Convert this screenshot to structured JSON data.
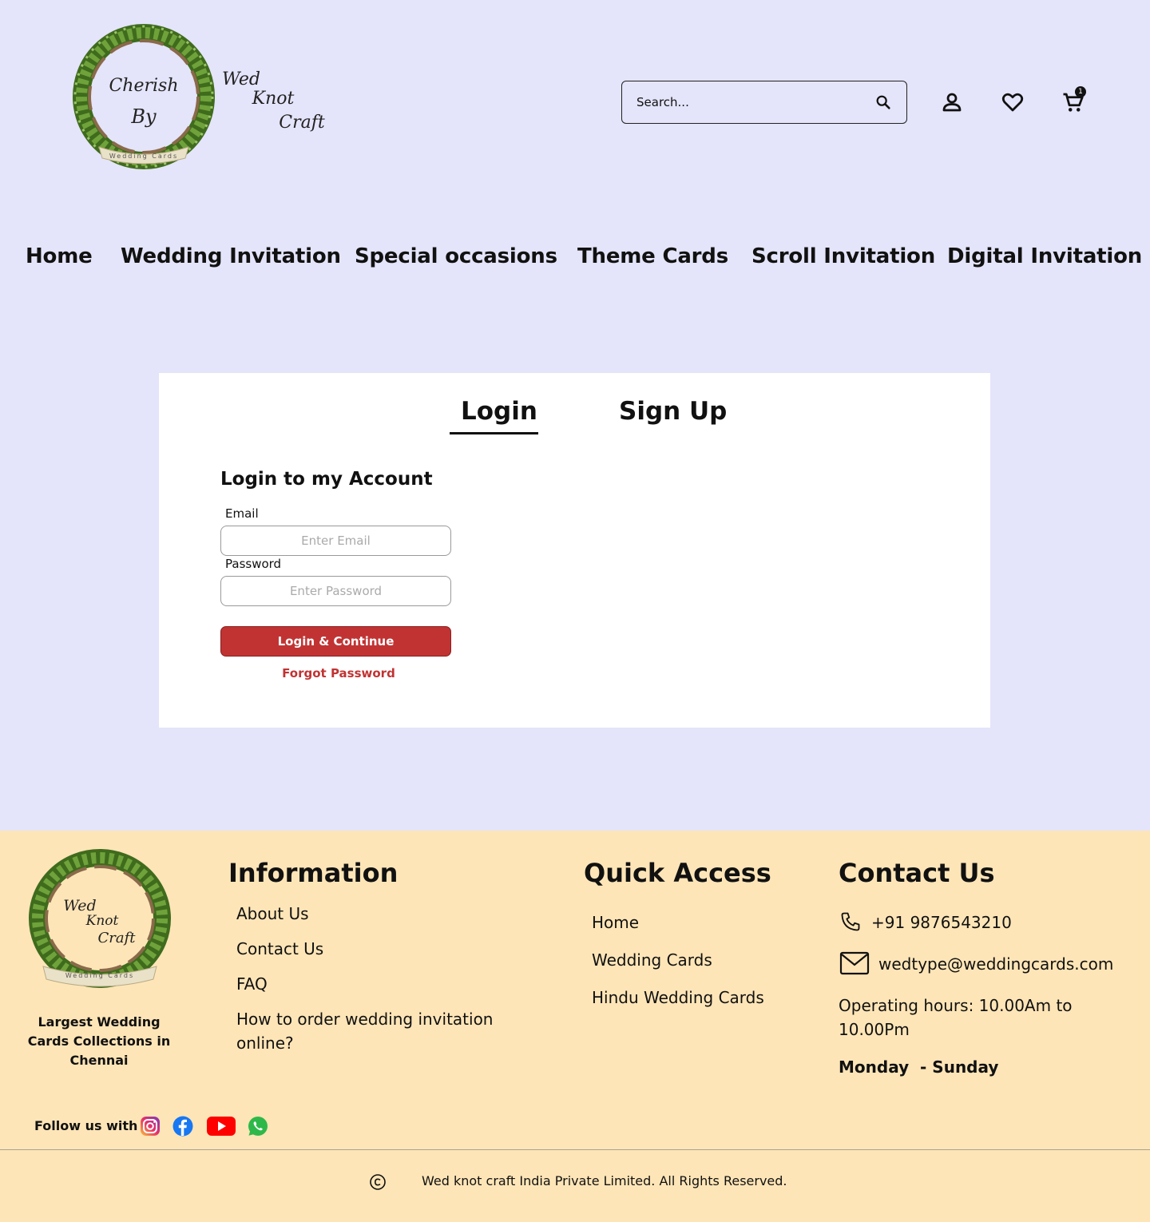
{
  "header": {
    "logo": {
      "left_text_lines": [
        "Cherish",
        "By"
      ],
      "right_text_lines": [
        "Wed",
        "Knot",
        "Craft"
      ],
      "ribbon": "Wedding Cards",
      "colors": {
        "leaf": "#5d8f2e",
        "leaf_dark": "#3f6b1d",
        "vine": "#8a6a4a",
        "ribbon": "#e9e1c8"
      }
    },
    "search": {
      "placeholder": "Search...",
      "icon": "search-icon"
    },
    "icons": {
      "account": "user-icon",
      "wishlist": "heart-icon",
      "cart": "cart-icon"
    },
    "cart_count": "1"
  },
  "nav": {
    "items": [
      {
        "label": "Home"
      },
      {
        "label": "Wedding Invitation"
      },
      {
        "label": "Special occasions"
      },
      {
        "label": "Theme Cards"
      },
      {
        "label": "Scroll Invitation"
      },
      {
        "label": "Digital Invitation"
      }
    ]
  },
  "auth": {
    "tabs": {
      "login": "Login",
      "signup": "Sign Up",
      "active": "login"
    },
    "title": "Login to my Account",
    "email": {
      "label": "Email",
      "placeholder": "Enter Email",
      "value": ""
    },
    "password": {
      "label": "Password",
      "placeholder": "Enter Password",
      "value": ""
    },
    "submit_label": "Login & Continue",
    "forgot_label": "Forgot Password",
    "colors": {
      "primary": "#c13333"
    }
  },
  "footer": {
    "logo": {
      "text_lines": [
        "Wed",
        "Knot",
        "Craft"
      ],
      "ribbon": "Wedding Cards"
    },
    "tagline": "Largest Wedding Cards Collections in Chennai",
    "information": {
      "heading": "Information",
      "links": [
        "About Us",
        "Contact Us",
        "FAQ",
        "How to order wedding invitation online?"
      ]
    },
    "quick_access": {
      "heading": "Quick Access",
      "links": [
        "Home",
        "Wedding Cards",
        "Hindu Wedding Cards"
      ]
    },
    "contact": {
      "heading": "Contact Us",
      "phone": "+91 9876543210",
      "email": "wedtype@weddingcards.com",
      "hours": "Operating hours: 10.00Am to 10.00Pm",
      "days": "Monday  - Sunday"
    },
    "follow_label": "Follow us with",
    "social": [
      "instagram-icon",
      "facebook-icon",
      "youtube-icon",
      "whatsapp-icon"
    ],
    "copyright": "Wed knot craft India Private Limited. All Rights Reserved.",
    "colors": {
      "background": "#fee5b7"
    }
  }
}
